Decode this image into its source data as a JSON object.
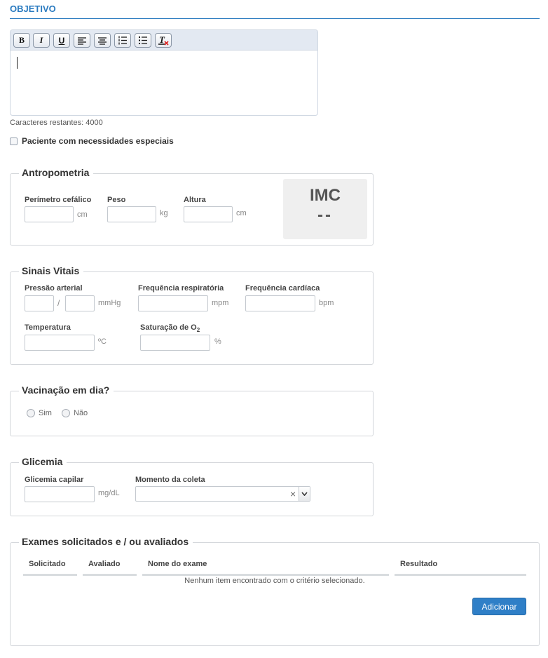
{
  "section": {
    "title": "OBJETIVO"
  },
  "editor": {
    "toolbar": [
      {
        "name": "bold-button",
        "glyph": "B"
      },
      {
        "name": "italic-button",
        "glyph": "I"
      },
      {
        "name": "underline-button",
        "glyph": "U"
      },
      {
        "name": "align-left-button",
        "icon": "align-left-icon"
      },
      {
        "name": "align-center-button",
        "icon": "align-center-icon"
      },
      {
        "name": "ordered-list-button",
        "icon": "ordered-list-icon"
      },
      {
        "name": "unordered-list-button",
        "icon": "unordered-list-icon"
      },
      {
        "name": "clear-format-button",
        "icon": "clear-format-icon"
      }
    ],
    "remaining_chars": "Caracteres restantes: 4000"
  },
  "special_needs": {
    "label": "Paciente com necessidades especiais",
    "checked": false
  },
  "antropometria": {
    "legend": "Antropometria",
    "perimetro": {
      "label": "Perímetro cefálico",
      "unit": "cm",
      "value": ""
    },
    "peso": {
      "label": "Peso",
      "unit": "kg",
      "value": ""
    },
    "altura": {
      "label": "Altura",
      "unit": "cm",
      "value": ""
    },
    "imc": {
      "label": "IMC",
      "value": "--"
    }
  },
  "sinais_vitais": {
    "legend": "Sinais Vitais",
    "pressao": {
      "label": "Pressão arterial",
      "separator": "/",
      "unit": "mmHg"
    },
    "freq_resp": {
      "label": "Frequência respiratória",
      "unit": "mpm"
    },
    "freq_card": {
      "label": "Frequência cardíaca",
      "unit": "bpm"
    },
    "temperatura": {
      "label": "Temperatura",
      "unit": "ºC"
    },
    "saturacao": {
      "label": "Saturação de O",
      "label_sub": "2",
      "unit": "%"
    }
  },
  "vacinacao": {
    "legend": "Vacinação em dia?",
    "options": [
      "Sim",
      "Não"
    ]
  },
  "glicemia": {
    "legend": "Glicemia",
    "capilar": {
      "label": "Glicemia capilar",
      "unit": "mg/dL"
    },
    "momento": {
      "label": "Momento da coleta",
      "value": ""
    }
  },
  "exames": {
    "legend": "Exames solicitados e / ou avaliados",
    "columns": [
      "Solicitado",
      "Avaliado",
      "Nome do exame",
      "Resultado"
    ],
    "empty_message": "Nenhum item encontrado com o critério selecionado.",
    "add_button": "Adicionar"
  },
  "colors": {
    "accent": "#2b7bc0",
    "button": "#2f7fc7"
  }
}
